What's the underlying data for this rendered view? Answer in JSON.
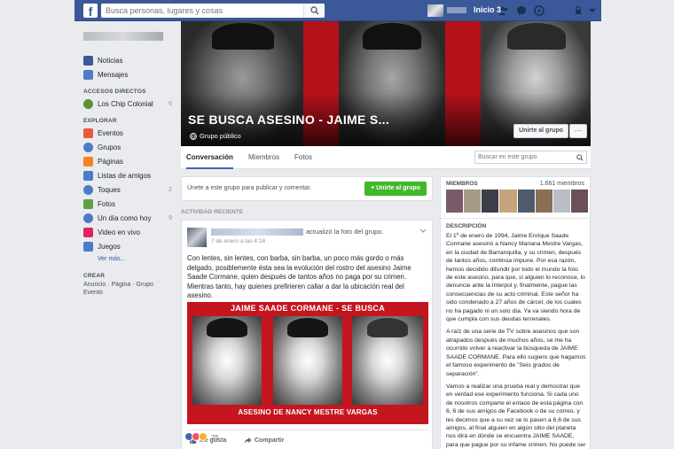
{
  "topbar": {
    "logo": "f",
    "search_placeholder": "Busca personas, lugares y cosas",
    "home_label": "Inicio",
    "home_count": "3"
  },
  "left": {
    "items": [
      {
        "label": "Noticias",
        "color": "#3b5998"
      },
      {
        "label": "Mensajes",
        "color": "#4a7cc7"
      }
    ],
    "shortcuts_heading": "ACCESOS DIRECTOS",
    "shortcuts": [
      {
        "label": "Los Chip Colonial",
        "count": "6",
        "color": "#5e8f3a"
      }
    ],
    "explore_heading": "EXPLORAR",
    "explore": [
      {
        "label": "Eventos",
        "count": "",
        "color": "#e9573f"
      },
      {
        "label": "Grupos",
        "count": "",
        "color": "#4a7cc7"
      },
      {
        "label": "Páginas",
        "count": "",
        "color": "#f58220"
      },
      {
        "label": "Listas de amigos",
        "count": "",
        "color": "#4a7cc7"
      },
      {
        "label": "Toques",
        "count": "2",
        "color": "#4a7cc7"
      },
      {
        "label": "Fotos",
        "count": "",
        "color": "#5fa046"
      },
      {
        "label": "Un día como hoy",
        "count": "9",
        "color": "#4a7cc7"
      },
      {
        "label": "Video en vivo",
        "count": "",
        "color": "#e0245e"
      },
      {
        "label": "Juegos",
        "count": "",
        "color": "#4a7cc7"
      }
    ],
    "see_more": "Ver más...",
    "create_heading": "CREAR",
    "create_line1": "Anuncio · Página · Grupo",
    "create_line2": "Evento"
  },
  "cover": {
    "title": "SE BUSCA ASESINO - JAIME S...",
    "privacy": "Grupo público",
    "join_label": "Unirte al grupo",
    "more_label": "···"
  },
  "tabs": {
    "items": [
      "Conversación",
      "Miembros",
      "Fotos"
    ],
    "search_placeholder": "Buscar en este grupo"
  },
  "join_bar": {
    "text": "Únete a este grupo para publicar y comentar.",
    "button": "+ Unirte al grupo"
  },
  "activity_label": "ACTIVIDAD RECIENTE",
  "post": {
    "action": "actualizó la foto del grupo.",
    "time": "7 de enero a las 4:18",
    "text": "Con lentes, sin lentes, con barba, sin barba, un poco más gordo o más delgado, posiblemente ésta sea la evolución del rostro del asesino Jaime Saade Cormane, quien después de tantos años no paga por su crimen. Mientras tanto, hay quienes prefirieren callar a dar la ubicación real del asesino.",
    "poster_top": "JAIME SAADE CORMANE - SE BUSCA",
    "poster_bottom": "ASESINO DE NANCY MESTRE VARGAS",
    "like": "Me gusta",
    "share": "Compartir",
    "reactions_count": "25"
  },
  "right": {
    "members_label": "MIEMBROS",
    "members_count": "1.661 miembros",
    "description_label": "DESCRIPCIÓN",
    "desc_p1": "El 1º de enero de 1994, Jaime Enrique Saade Cormane asesinó a Nancy Mariana Mestre Vargas, en la ciudad de Barranquilla, y su crimen, después de tantos años, continúa impune. Por esa razón, hemos decidido difundir por todo el mundo la foto de este asesino, para que, si alguien lo reconoce, lo denuncie ante la Interpol y, finalmente, pague las consecuencias de su acto criminal. Este señor ha sido condenado a 27 años de cárcel, de los cuales no ha pagado ni un solo día. Ya va siendo hora de que cumpla con sus deudas terrenales.",
    "desc_p2": "A raíz de una serie de TV sobre asesinos que son atrapados después de muchos años, se me ha ocurrido volver a reactivar la búsqueda de JAIME SAADE CORMANE. Para ello sugiero que hagamos el famoso experimento de \"Seis grados de separación\".",
    "desc_p3": "Vamos a realizar una prueba real y demostrar que en verdad ese experimento funciona. Si cada uno de nosotros comparte el enlace de esta página con 6, 6 de sus amigos de Facebook o de su correo, y les decimos que a su vez se lo pasen a 6,6 de sus amigos, al final alguien en algún sitio del planeta nos dirá en dónde se encuentra JAIME SAADE, para que pague por su infame crimen. No puede ser que los padres de NANCY MESTRE sigan se mueran y"
  }
}
